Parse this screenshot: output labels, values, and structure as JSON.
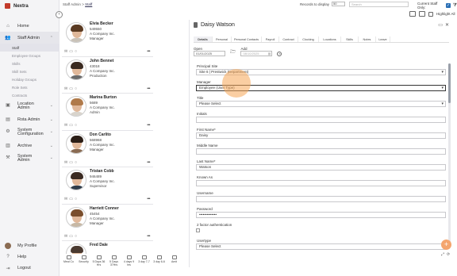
{
  "app": {
    "name": "Nextra"
  },
  "sidebar": {
    "items": [
      {
        "label": "Home",
        "icon": "home-icon"
      },
      {
        "label": "Staff Admin",
        "icon": "users-icon"
      },
      {
        "label": "Location Admin",
        "icon": "location-icon"
      },
      {
        "label": "Rota Admin",
        "icon": "calendar-icon"
      },
      {
        "label": "System Configuration",
        "icon": "gear-icon"
      },
      {
        "label": "Archive",
        "icon": "archive-icon"
      },
      {
        "label": "System Admin",
        "icon": "wrench-icon"
      }
    ],
    "sub_items": [
      "Staff",
      "Employee Groups",
      "Skills",
      "Skill Sets",
      "Holiday Groups",
      "Role Sets",
      "Contracts"
    ],
    "bottom": [
      {
        "label": "My Profile"
      },
      {
        "label": "Help"
      },
      {
        "label": "Logout"
      }
    ]
  },
  "topbar": {
    "breadcrumb_root": "Staff Admin",
    "breadcrumb_sep": ">",
    "breadcrumb_current": "Staff",
    "records_label": "Records to display",
    "records_value": "50",
    "search_placeholder": "Search",
    "current_staff_label": "Current Staff Only:",
    "highlight_label": "Highlight All"
  },
  "staff": [
    {
      "name": "Elvia Becker",
      "id": "549550",
      "company": "A Company Inc.",
      "role": "Manager",
      "hair": "#5a3a22",
      "shirt": "#c9c2b8"
    },
    {
      "name": "John Bennet",
      "id": "43018",
      "company": "A Company Inc.",
      "role": "Production",
      "hair": "#3a2a20",
      "shirt": "#6b6b6b"
    },
    {
      "name": "Marina Burton",
      "id": "5689",
      "company": "A Company Inc.",
      "role": "Admin",
      "hair": "#b07a4a",
      "shirt": "#d9d4cc"
    },
    {
      "name": "Don Carlito",
      "id": "568968",
      "company": "A Company Inc.",
      "role": "Manager",
      "hair": "#2b1e16",
      "shirt": "#8a6b52"
    },
    {
      "name": "Tristan Cobb",
      "id": "946489",
      "company": "A Company Inc.",
      "role": "Supervisor",
      "hair": "#3b2b22",
      "shirt": "#2f3c4a"
    },
    {
      "name": "Harriett Conner",
      "id": "45454",
      "company": "A Company Inc.",
      "role": "Manager",
      "hair": "#7a4e2c",
      "shirt": "#c7b8a5"
    },
    {
      "name": "Fred Dale",
      "id": "",
      "company": "",
      "role": "",
      "hair": "#4a3a30",
      "shirt": "#888888"
    }
  ],
  "bottom_tools": [
    "Meal Co",
    "Security",
    "5 Days 36 Hrs",
    "5 Days 37Hrs",
    "4 days 9 hrs",
    "3 day 7-7",
    "3 day 6-6",
    "Amit"
  ],
  "detail": {
    "name": "Daisy Watson",
    "tabs": [
      "Details",
      "Personal",
      "Personal Contacts",
      "Payroll",
      "Contract",
      "Clocking",
      "Locations",
      "Skills",
      "Notes",
      "Leave"
    ],
    "open_label": "Open",
    "open_date": "01/01/2025",
    "add_label": "Add",
    "add_date": "08/10/2025",
    "fields": [
      {
        "label": "Principal Site",
        "value": "Site 6 | Prestwick (Department)",
        "type": "select"
      },
      {
        "label": "Manager",
        "value": "Employee (User Type)",
        "type": "select"
      },
      {
        "label": "Title",
        "value": "Please Select",
        "type": "select"
      },
      {
        "label": "Initials",
        "value": "",
        "type": "text"
      },
      {
        "label": "First Name*",
        "value": "Daisy",
        "type": "text"
      },
      {
        "label": "Middle Name",
        "value": "",
        "type": "text"
      },
      {
        "label": "Last Name*",
        "value": "Watson",
        "type": "text"
      },
      {
        "label": "Known As",
        "value": "",
        "type": "text"
      },
      {
        "label": "Username",
        "value": "",
        "type": "text"
      },
      {
        "label": "Password",
        "value": "••••••••••••••",
        "type": "text"
      },
      {
        "label": "2 factor authentication",
        "value": "",
        "type": "checkbox"
      },
      {
        "label": "Usertype",
        "value": "Please Select",
        "type": "select"
      }
    ]
  },
  "fab_label": "+"
}
